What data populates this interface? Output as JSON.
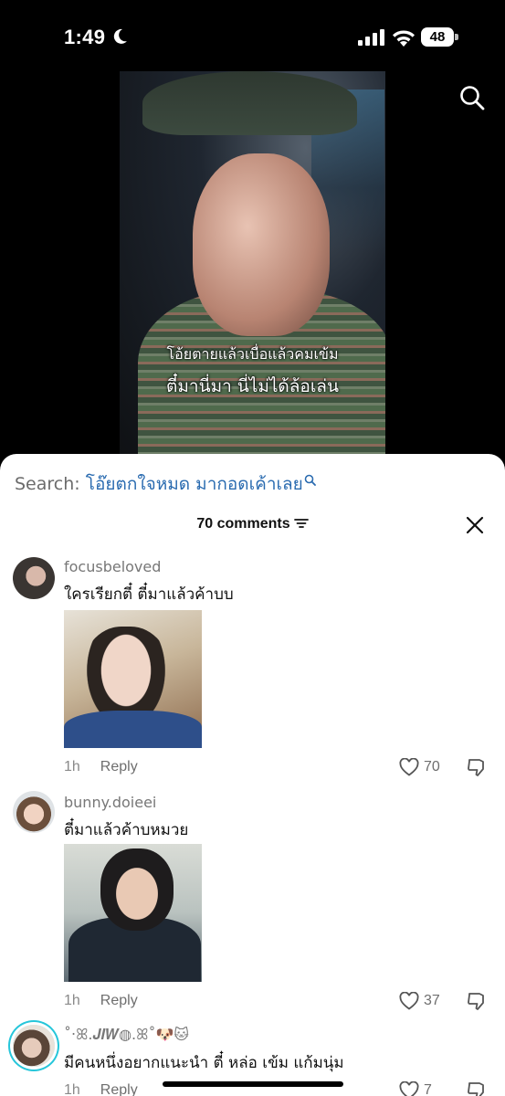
{
  "status_bar": {
    "time": "1:49",
    "battery": "48"
  },
  "video": {
    "subtitle_line1": "โอ้ยตายแล้วเบื่อแล้วคมเข้ม",
    "subtitle_line2": "ตี๋มานี่มา นี่ไม่ได้ล้อเล่น"
  },
  "comments_sheet": {
    "search_label": "Search:",
    "search_query": "โอ๊ยตกใจหมด มากอดเค้าเลย",
    "comment_count": "70 comments",
    "comments": [
      {
        "username": "focusbeloved",
        "text": "ใครเรียกตี๋ ตี๋มาแล้วค้าบบ",
        "time": "1h",
        "reply_label": "Reply",
        "likes": "70"
      },
      {
        "username": "bunny.doieei",
        "text": "ตี๋มาแล้วค้าบหมวย",
        "time": "1h",
        "reply_label": "Reply",
        "likes": "37"
      },
      {
        "username": "˚‧ꕤ.𝑱𝑰𝑾◍.ꕤ˚🐶🐱",
        "text": "มีคนหนึ่งอยากแนะนำ ตี๋ หล่อ เข้ม แก้มนุ่ม",
        "time": "1h",
        "reply_label": "Reply",
        "likes": "7"
      }
    ]
  },
  "colors": {
    "accent_link": "#2a6bb0",
    "story_ring": "#26c6da"
  }
}
